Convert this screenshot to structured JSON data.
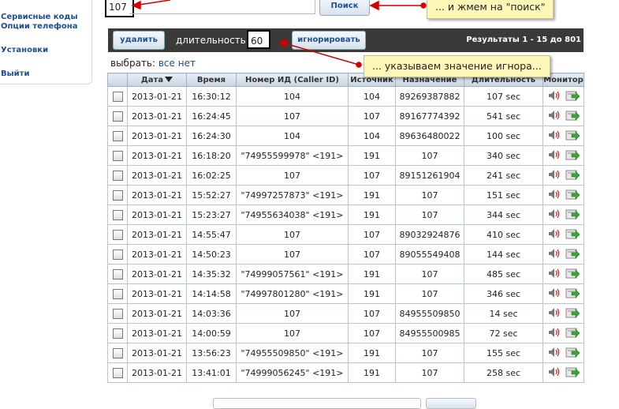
{
  "sidebar": {
    "items": [
      "Сервисные коды",
      "Опции телефона",
      "Установки",
      "Выйти"
    ]
  },
  "search": {
    "value": "107",
    "button_label": "Поиск"
  },
  "callouts": {
    "search_hint": "... и жмем на \"поиск\"",
    "ignore_hint": "... указываем значение игнора..."
  },
  "toolbar": {
    "delete_label": "удалить",
    "duration_label": "длительность",
    "duration_value": "60",
    "ignore_label": "игнорировать",
    "results_text": "Результаты 1 - 15 до 801"
  },
  "select": {
    "label": "выбрать:",
    "all": "все",
    "none": "нет"
  },
  "table": {
    "headers": [
      "Дата",
      "Время",
      "Номер ИД (Caller ID)",
      "Источник",
      "Назначение",
      "Длительность",
      "Монитор"
    ],
    "rows": [
      [
        "2013-01-21",
        "16:30:12",
        "104",
        "104",
        "89269387882",
        "107 sec"
      ],
      [
        "2013-01-21",
        "16:24:45",
        "107",
        "107",
        "89167774392",
        "541 sec"
      ],
      [
        "2013-01-21",
        "16:24:30",
        "104",
        "104",
        "89636480022",
        "100 sec"
      ],
      [
        "2013-01-21",
        "16:18:20",
        "\"74955599978\" <191>",
        "191",
        "107",
        "340 sec"
      ],
      [
        "2013-01-21",
        "16:02:25",
        "107",
        "107",
        "89151261904",
        "241 sec"
      ],
      [
        "2013-01-21",
        "15:52:27",
        "\"74997257873\" <191>",
        "191",
        "107",
        "151 sec"
      ],
      [
        "2013-01-21",
        "15:23:27",
        "\"74955634038\" <191>",
        "191",
        "107",
        "344 sec"
      ],
      [
        "2013-01-21",
        "14:55:47",
        "107",
        "107",
        "89032924876",
        "410 sec"
      ],
      [
        "2013-01-21",
        "14:50:23",
        "107",
        "107",
        "89055549408",
        "144 sec"
      ],
      [
        "2013-01-21",
        "14:35:32",
        "\"74999057561\" <191>",
        "191",
        "107",
        "485 sec"
      ],
      [
        "2013-01-21",
        "14:14:58",
        "\"74997801280\" <191>",
        "191",
        "107",
        "346 sec"
      ],
      [
        "2013-01-21",
        "14:03:36",
        "107",
        "107",
        "84955509850",
        "14 sec"
      ],
      [
        "2013-01-21",
        "14:00:59",
        "107",
        "107",
        "84955500985",
        "72 sec"
      ],
      [
        "2013-01-21",
        "13:56:23",
        "\"74955509850\" <191>",
        "191",
        "107",
        "155 sec"
      ],
      [
        "2013-01-21",
        "13:41:01",
        "\"74999056245\" <191>",
        "191",
        "107",
        "258 sec"
      ]
    ]
  },
  "icons": {
    "speaker": "speaker-icon",
    "download": "download-icon"
  },
  "colors": {
    "link": "#1f4f8f",
    "toolbar_bg": "#3a3a3a",
    "callout_bg": "#fdf8b8",
    "arrow": "#d00000"
  }
}
